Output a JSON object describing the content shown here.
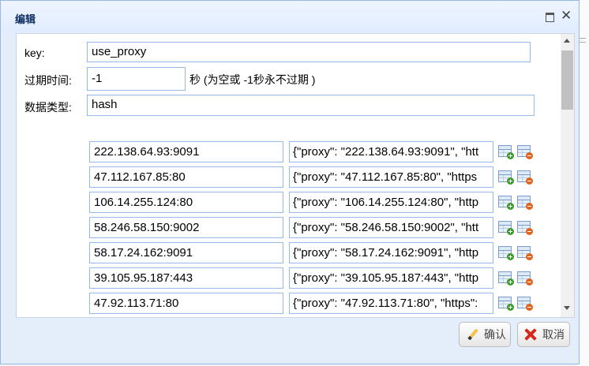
{
  "window": {
    "title": "编辑"
  },
  "form": {
    "key_label": "key:",
    "key_value": "use_proxy",
    "ttl_label": "过期时间:",
    "ttl_value": "-1",
    "ttl_hint": "秒 (为空或 -1秒永不过期 )",
    "type_label": "数据类型:",
    "type_value": "hash"
  },
  "rows": [
    {
      "field": "222.138.64.93:9091",
      "value": "{\"proxy\": \"222.138.64.93:9091\", \"htt"
    },
    {
      "field": "47.112.167.85:80",
      "value": "{\"proxy\": \"47.112.167.85:80\", \"https"
    },
    {
      "field": "106.14.255.124:80",
      "value": "{\"proxy\": \"106.14.255.124:80\", \"http"
    },
    {
      "field": "58.246.58.150:9002",
      "value": "{\"proxy\": \"58.246.58.150:9002\", \"htt"
    },
    {
      "field": "58.17.24.162:9091",
      "value": "{\"proxy\": \"58.17.24.162:9091\", \"http"
    },
    {
      "field": "39.105.95.187:443",
      "value": "{\"proxy\": \"39.105.95.187:443\", \"http"
    },
    {
      "field": "47.92.113.71:80",
      "value": "{\"proxy\": \"47.92.113.71:80\", \"https\":"
    }
  ],
  "buttons": {
    "ok": "确认",
    "cancel": "取消"
  },
  "icons": {
    "add_row": "table-add-icon",
    "delete_row": "table-delete-icon",
    "maximize": "maximize-icon",
    "close": "close-icon"
  }
}
